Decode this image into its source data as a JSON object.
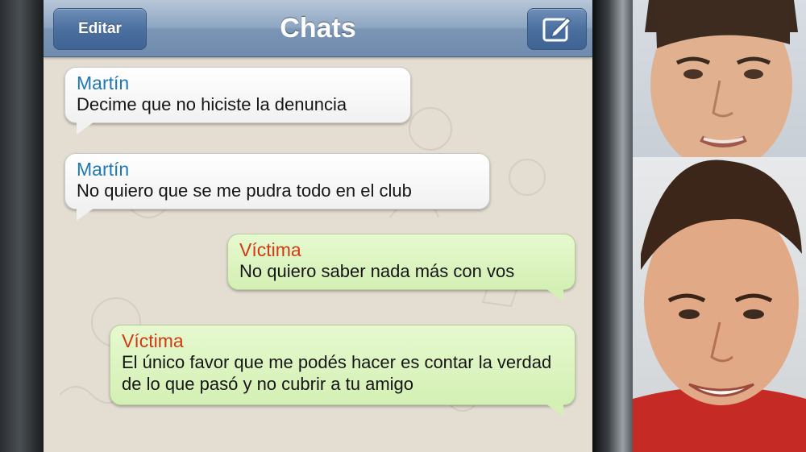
{
  "navbar": {
    "edit_label": "Editar",
    "title": "Chats",
    "compose_icon": "compose-icon"
  },
  "messages": [
    {
      "sender": "Martín",
      "text": "Decime que no hiciste la denuncia",
      "direction": "incoming"
    },
    {
      "sender": "Martín",
      "text": "No quiero que se me pudra todo en el club",
      "direction": "incoming"
    },
    {
      "sender": "Víctima",
      "text": "No quiero saber nada más con vos",
      "direction": "outgoing"
    },
    {
      "sender": "Víctima",
      "text": "El único favor que me podés hacer es contar la verdad de lo que pasó y no cubrir a tu amigo",
      "direction": "outgoing"
    }
  ],
  "colors": {
    "navbar": "#7b95b5",
    "incoming_sender": "#1f78b4",
    "outgoing_sender": "#d03a14",
    "incoming_bubble": "#ffffff",
    "outgoing_bubble": "#dcf4c0",
    "wallpaper": "#e4ddd2"
  },
  "photos": [
    {
      "subject": "young man portrait top"
    },
    {
      "subject": "young man smiling red shirt"
    }
  ]
}
